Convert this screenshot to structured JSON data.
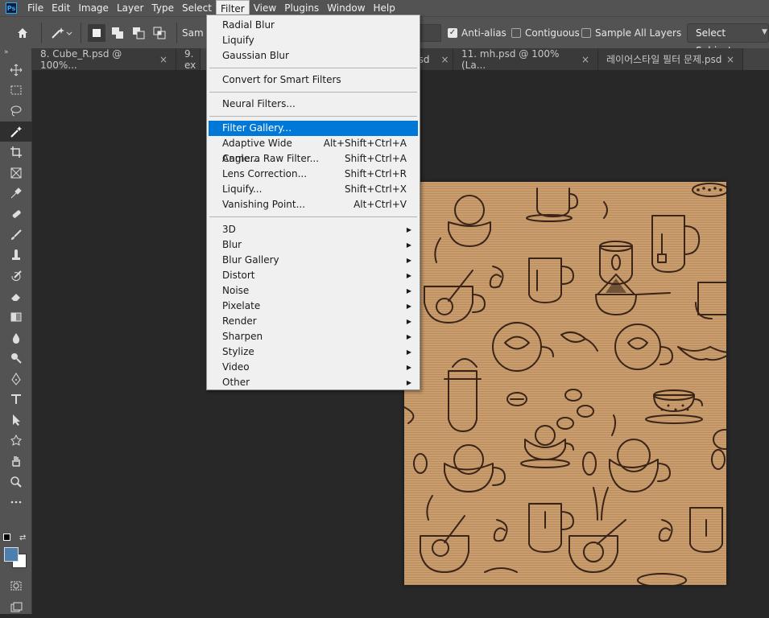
{
  "menubar": {
    "items": [
      "File",
      "Edit",
      "Image",
      "Layer",
      "Type",
      "Select",
      "Filter",
      "View",
      "Plugins",
      "Window",
      "Help"
    ],
    "active": "Filter"
  },
  "options": {
    "sample_label": "Sam",
    "anti_alias": "Anti-alias",
    "contiguous": "Contiguous",
    "sample_all_layers": "Sample All Layers",
    "select_subject": "Select Subject"
  },
  "tabs": [
    "8. Cube_R.psd @ 100%...",
    "9. ex",
    "psd",
    "11. mh.psd @ 100% (La...",
    "레이어스타일 필터 문제.psd"
  ],
  "filter_menu": {
    "group1": [
      {
        "label": "Radial Blur",
        "shortcut": ""
      },
      {
        "label": "Liquify",
        "shortcut": ""
      },
      {
        "label": "Gaussian Blur",
        "shortcut": ""
      }
    ],
    "group2": [
      {
        "label": "Convert for Smart Filters",
        "shortcut": ""
      }
    ],
    "group3": [
      {
        "label": "Neural Filters...",
        "shortcut": ""
      }
    ],
    "group4": [
      {
        "label": "Filter Gallery...",
        "shortcut": ""
      },
      {
        "label": "Adaptive Wide Angle...",
        "shortcut": "Alt+Shift+Ctrl+A"
      },
      {
        "label": "Camera Raw Filter...",
        "shortcut": "Shift+Ctrl+A"
      },
      {
        "label": "Lens Correction...",
        "shortcut": "Shift+Ctrl+R"
      },
      {
        "label": "Liquify...",
        "shortcut": "Shift+Ctrl+X"
      },
      {
        "label": "Vanishing Point...",
        "shortcut": "Alt+Ctrl+V"
      }
    ],
    "group5": [
      {
        "label": "3D"
      },
      {
        "label": "Blur"
      },
      {
        "label": "Blur Gallery"
      },
      {
        "label": "Distort"
      },
      {
        "label": "Noise"
      },
      {
        "label": "Pixelate"
      },
      {
        "label": "Render"
      },
      {
        "label": "Sharpen"
      },
      {
        "label": "Stylize"
      },
      {
        "label": "Video"
      },
      {
        "label": "Other"
      }
    ],
    "highlighted": "Filter Gallery..."
  },
  "tools": [
    "move-tool",
    "marquee-tool",
    "lasso-tool",
    "magic-wand-tool",
    "crop-tool",
    "frame-tool",
    "eyedropper-tool",
    "healing-brush-tool",
    "brush-tool",
    "clone-stamp-tool",
    "history-brush-tool",
    "eraser-tool",
    "gradient-tool",
    "blur-tool",
    "dodge-tool",
    "pen-tool",
    "type-tool",
    "path-selection-tool",
    "shape-tool",
    "hand-tool",
    "zoom-tool",
    "more-tools"
  ],
  "colors": {
    "foreground": "#4a7fb0",
    "background": "#ffffff",
    "highlight": "#0078d7",
    "canvas_paper": "#c79b6c",
    "ink": "#3a2418"
  }
}
